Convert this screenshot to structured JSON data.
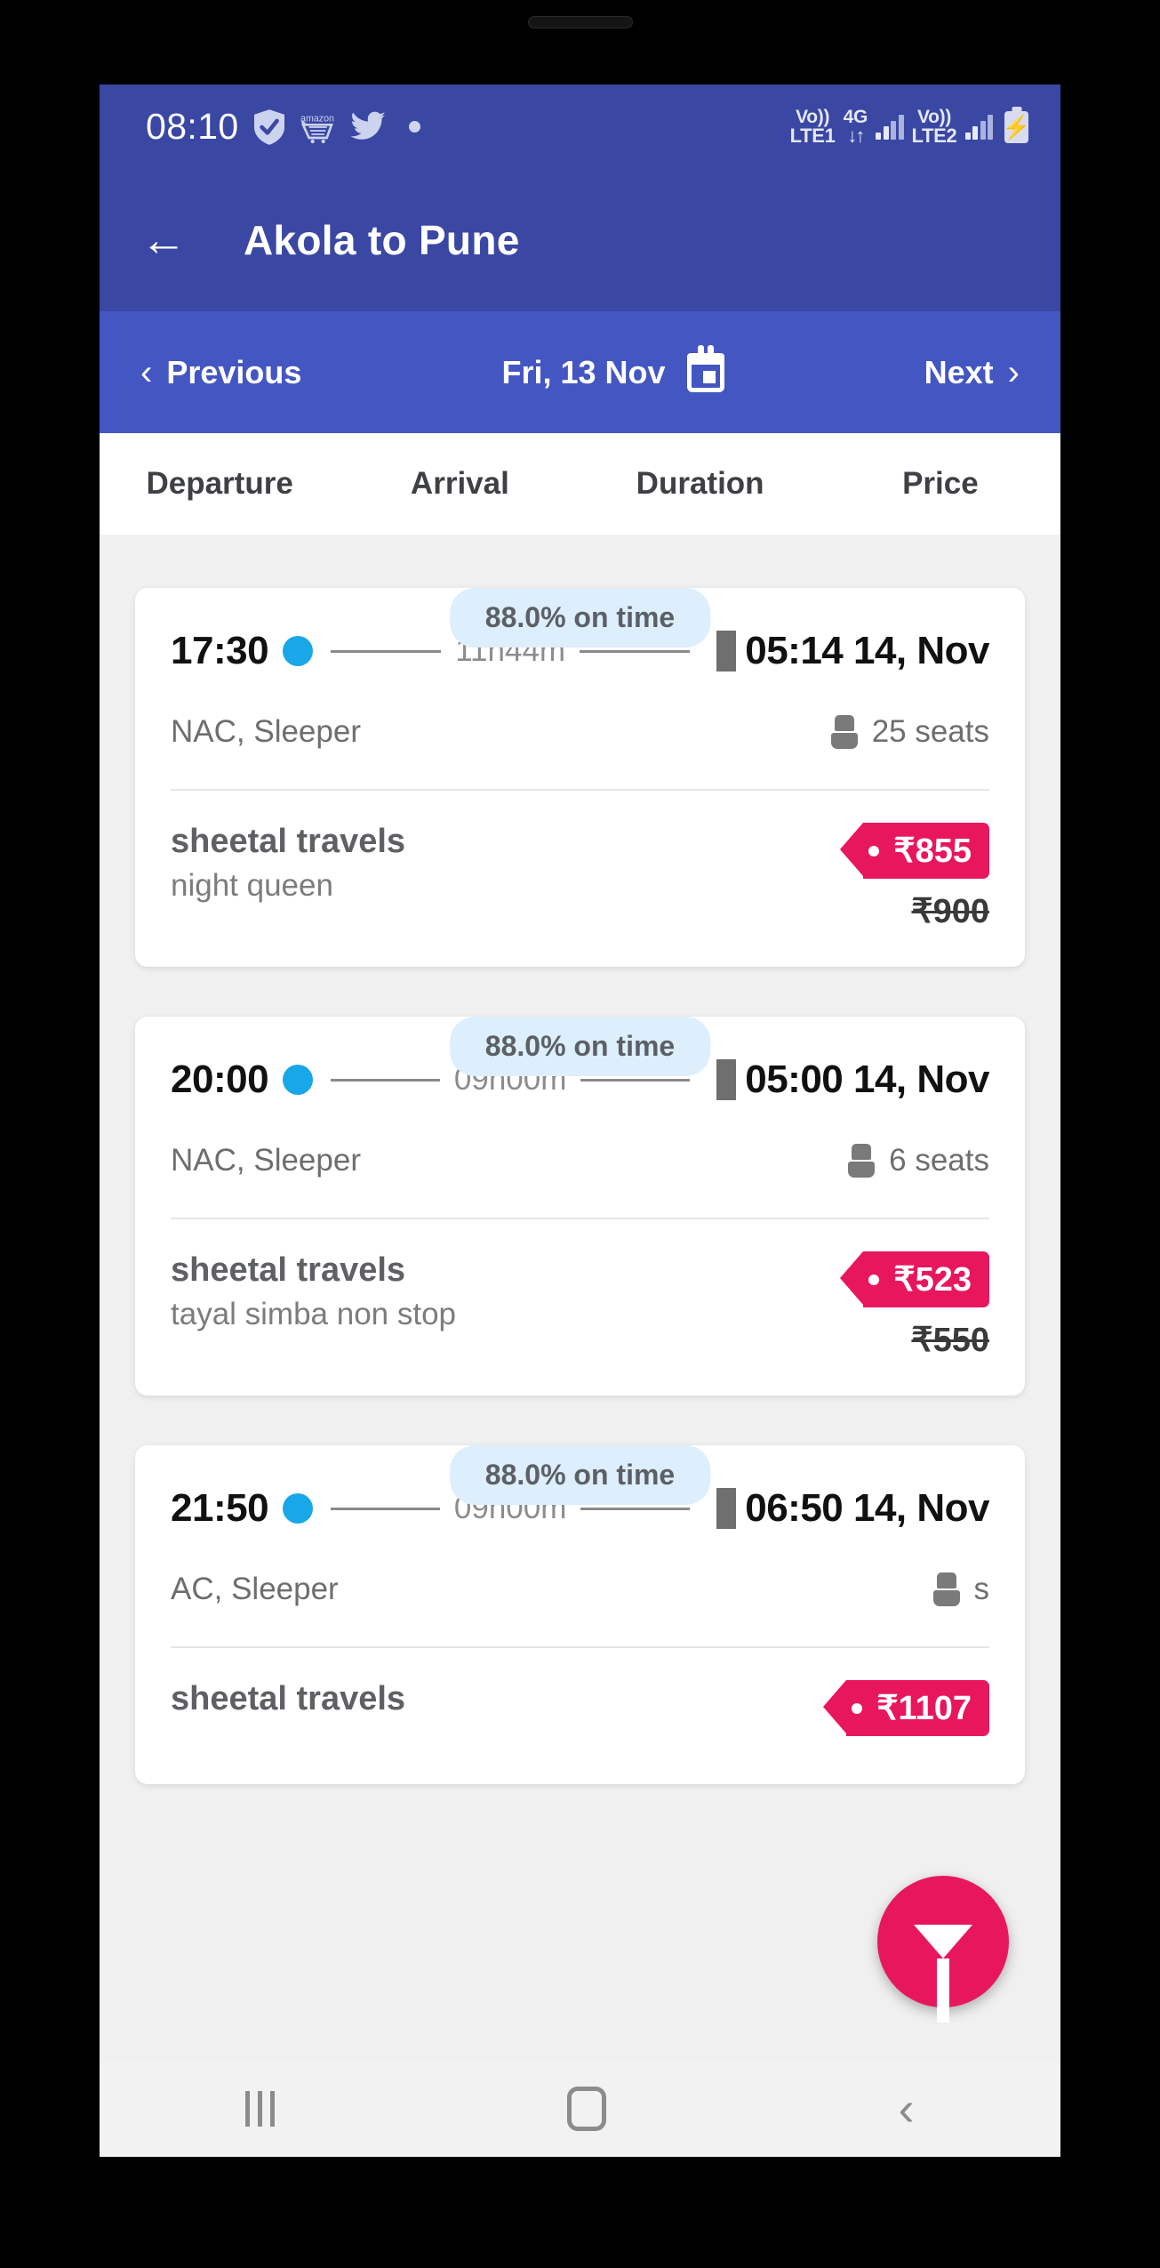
{
  "status_bar": {
    "time": "08:10",
    "left_icons": [
      "shield-check-icon",
      "amazon-cart-icon",
      "twitter-bird-icon",
      "dot-indicator"
    ],
    "sim1_line1": "Vo))",
    "sim1_line2": "LTE1",
    "network_type": "4G",
    "data_arrows": "↓↑",
    "sim2_line1": "Vo))",
    "sim2_line2": "LTE2",
    "battery": "battery-charging-icon"
  },
  "app_bar": {
    "back_icon": "←",
    "title": "Akola to Pune"
  },
  "date_nav": {
    "previous_label": "Previous",
    "previous_chevron": "‹",
    "date": "Fri, 13 Nov",
    "calendar_icon": "calendar-icon",
    "next_label": "Next",
    "next_chevron": "›"
  },
  "sort_tabs": [
    {
      "label": "Departure"
    },
    {
      "label": "Arrival"
    },
    {
      "label": "Duration"
    },
    {
      "label": "Price"
    }
  ],
  "buses": [
    {
      "on_time": "88.0% on time",
      "departure": "17:30",
      "duration": "11h44m",
      "arrival": "05:14 14, Nov",
      "bus_type": "NAC, Sleeper",
      "seats": "25 seats",
      "operator": "sheetal travels",
      "service": "night queen",
      "price": "₹855",
      "price_old": "₹900"
    },
    {
      "on_time": "88.0% on time",
      "departure": "20:00",
      "duration": "09h00m",
      "arrival": "05:00 14, Nov",
      "bus_type": "NAC, Sleeper",
      "seats": "6 seats",
      "operator": "sheetal travels",
      "service": "tayal simba non stop",
      "price": "₹523",
      "price_old": "₹550"
    },
    {
      "on_time": "88.0% on time",
      "departure": "21:50",
      "duration": "09h00m",
      "arrival": "06:50 14, Nov",
      "bus_type": "AC, Sleeper",
      "seats": "s",
      "operator": "sheetal travels",
      "service": "",
      "price": "₹1107",
      "price_old": ""
    }
  ],
  "filter_fab": {
    "icon": "filter-funnel-icon"
  },
  "android_nav": {
    "recents": "recents-icon",
    "home": "home-icon",
    "back": "‹"
  },
  "colors": {
    "status_bar": "#3a47a3",
    "app_bar": "#3a47a3",
    "date_nav": "#4456c2",
    "accent_pink": "#e8175d",
    "badge_blue": "#ddeefc",
    "dot_blue": "#18a7e8"
  }
}
